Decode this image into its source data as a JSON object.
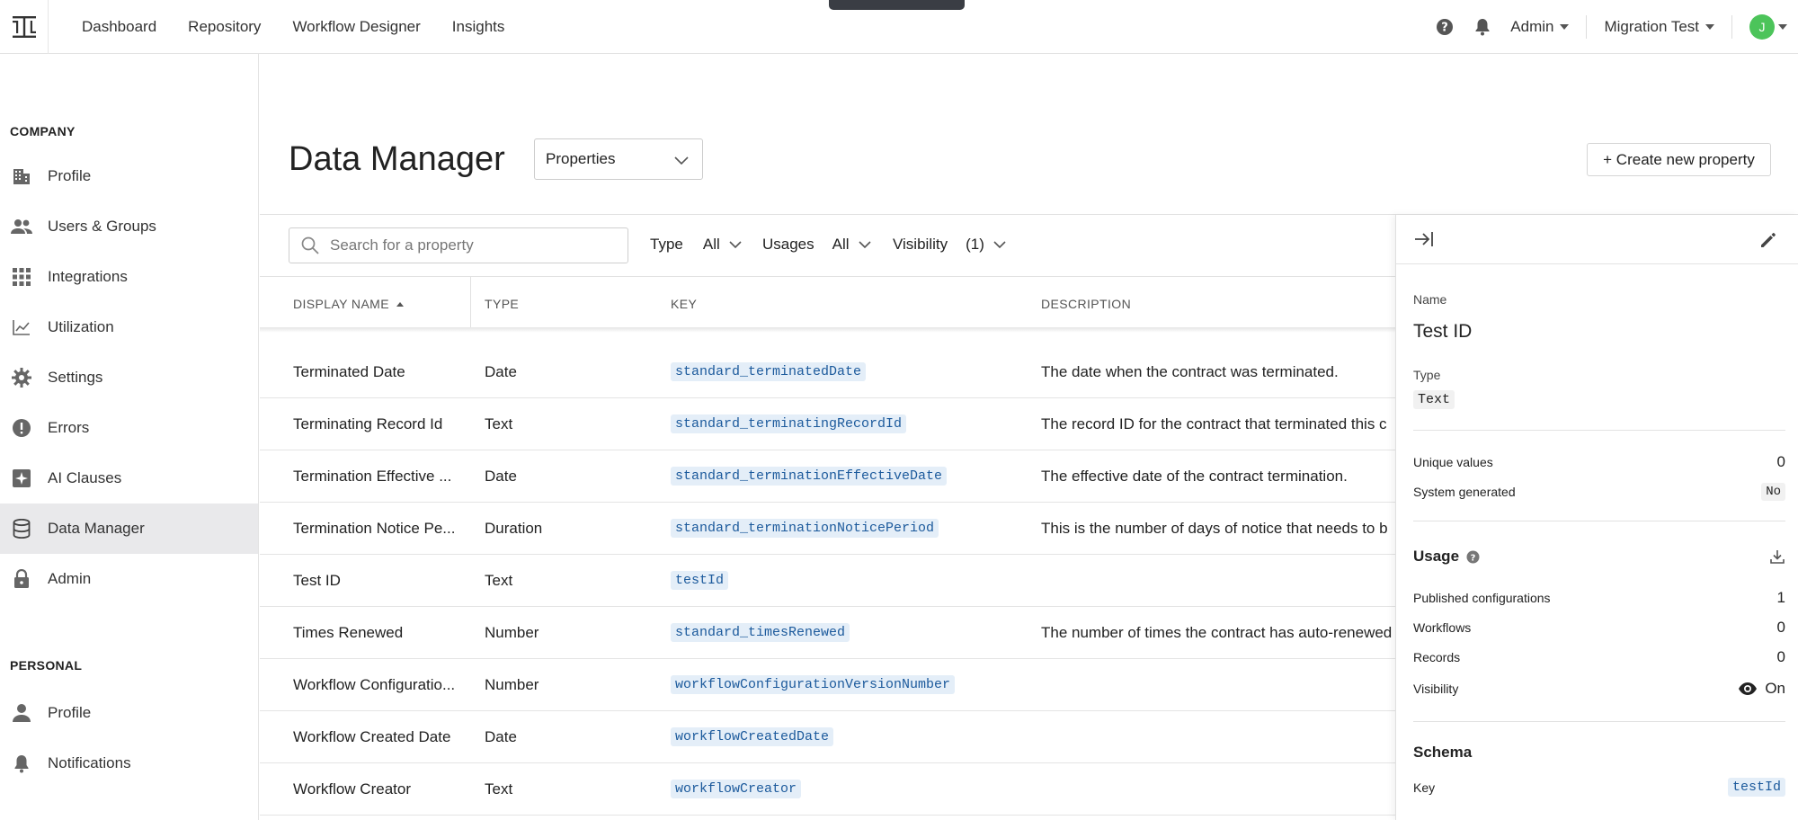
{
  "nav": {
    "links": [
      "Dashboard",
      "Repository",
      "Workflow Designer",
      "Insights"
    ],
    "admin_menu": "Admin",
    "workspace_menu": "Migration Test",
    "avatar_initial": "J",
    "avatar_color": "#4cc45a"
  },
  "sidebar": {
    "company_heading": "COMPANY",
    "company_items": [
      {
        "label": "Profile",
        "icon": "building-icon"
      },
      {
        "label": "Users & Groups",
        "icon": "users-icon"
      },
      {
        "label": "Integrations",
        "icon": "grid-icon"
      },
      {
        "label": "Utilization",
        "icon": "chart-icon"
      },
      {
        "label": "Settings",
        "icon": "gear-icon"
      },
      {
        "label": "Errors",
        "icon": "alert-icon"
      },
      {
        "label": "AI Clauses",
        "icon": "sparkle-icon"
      },
      {
        "label": "Data Manager",
        "icon": "database-icon",
        "active": true
      },
      {
        "label": "Admin",
        "icon": "lock-icon"
      }
    ],
    "personal_heading": "PERSONAL",
    "personal_items": [
      {
        "label": "Profile",
        "icon": "person-icon"
      },
      {
        "label": "Notifications",
        "icon": "bell-icon"
      }
    ]
  },
  "header": {
    "title": "Data Manager",
    "view_select": "Properties",
    "create_button": "+ Create new property"
  },
  "filters": {
    "search_placeholder": "Search for a property",
    "type_label": "Type",
    "type_value": "All",
    "usages_label": "Usages",
    "usages_value": "All",
    "visibility_label": "Visibility",
    "visibility_value": "(1)"
  },
  "table": {
    "columns": [
      "DISPLAY NAME",
      "TYPE",
      "KEY",
      "DESCRIPTION"
    ],
    "rows": [
      {
        "name": "Terminated Date",
        "type": "Date",
        "key": "standard_terminatedDate",
        "description": "The date when the contract was terminated."
      },
      {
        "name": "Terminating Record Id",
        "type": "Text",
        "key": "standard_terminatingRecordId",
        "description": "The record ID for the contract that terminated this c"
      },
      {
        "name": "Termination Effective ...",
        "type": "Date",
        "key": "standard_terminationEffectiveDate",
        "description": "The effective date of the contract termination."
      },
      {
        "name": "Termination Notice Pe...",
        "type": "Duration",
        "key": "standard_terminationNoticePeriod",
        "description": "This is the number of days of notice that needs to b"
      },
      {
        "name": "Test ID",
        "type": "Text",
        "key": "testId",
        "description": ""
      },
      {
        "name": "Times Renewed",
        "type": "Number",
        "key": "standard_timesRenewed",
        "description": "The number of times the contract has auto-renewed"
      },
      {
        "name": "Workflow Configuratio...",
        "type": "Number",
        "key": "workflowConfigurationVersionNumber",
        "description": ""
      },
      {
        "name": "Workflow Created Date",
        "type": "Date",
        "key": "workflowCreatedDate",
        "description": ""
      },
      {
        "name": "Workflow Creator",
        "type": "Text",
        "key": "workflowCreator",
        "description": ""
      }
    ]
  },
  "panel": {
    "name_label": "Name",
    "name_value": "Test ID",
    "type_label": "Type",
    "type_value": "Text",
    "unique_values_label": "Unique values",
    "unique_values": "0",
    "system_generated_label": "System generated",
    "system_generated": "No",
    "usage_heading": "Usage",
    "published_configurations_label": "Published configurations",
    "published_configurations": "1",
    "workflows_label": "Workflows",
    "workflows": "0",
    "records_label": "Records",
    "records": "0",
    "visibility_label": "Visibility",
    "visibility_value": "On",
    "schema_heading": "Schema",
    "key_label": "Key",
    "key_value": "testId"
  }
}
